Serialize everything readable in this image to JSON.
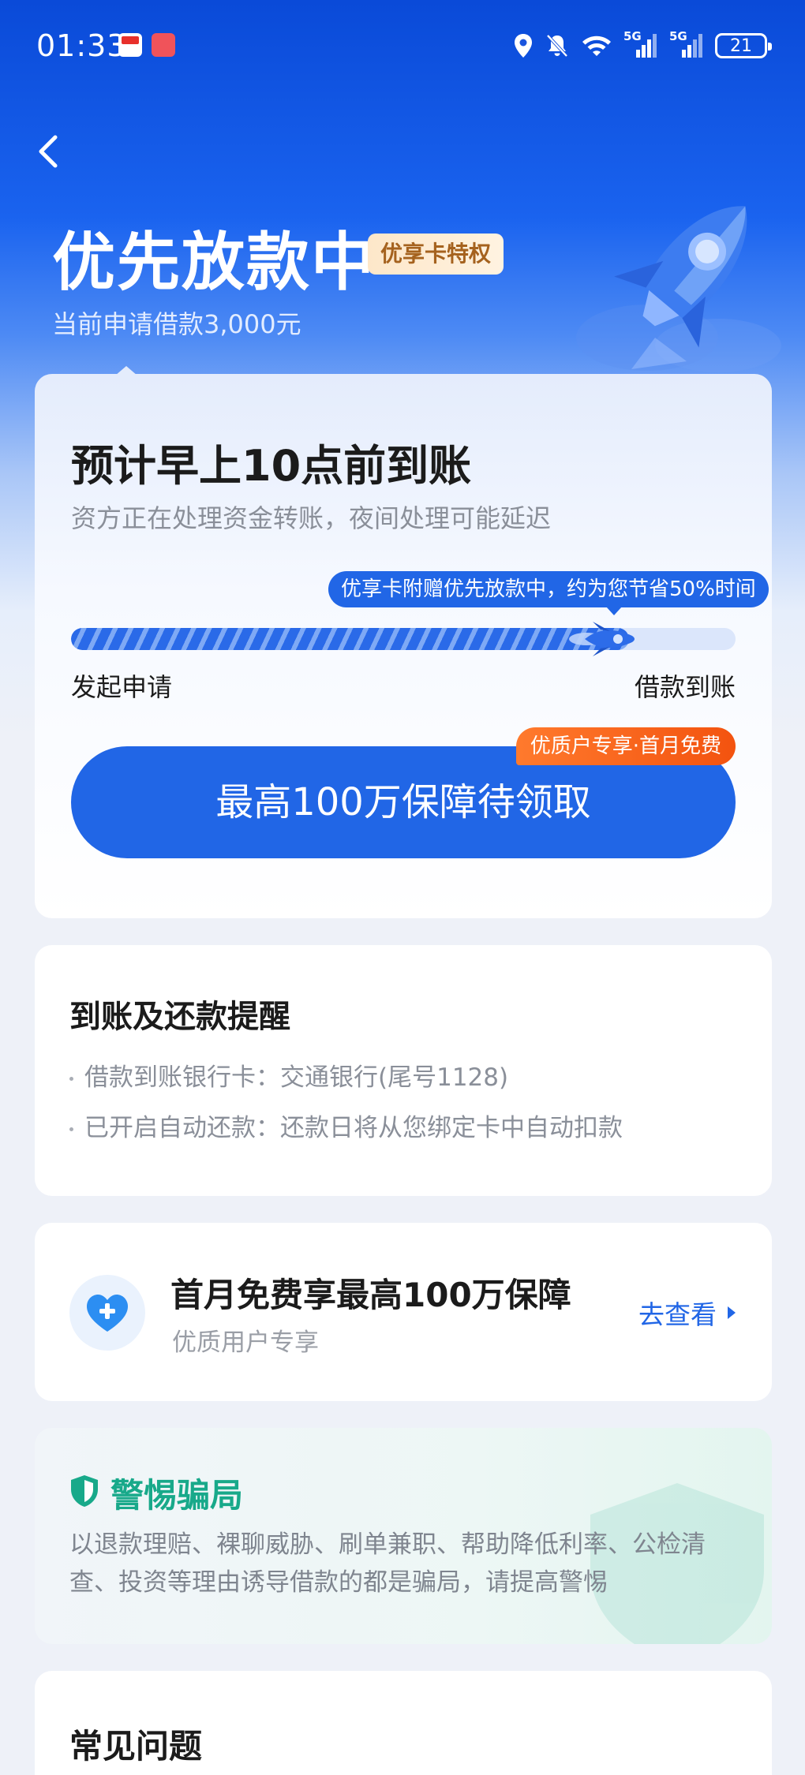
{
  "status_bar": {
    "time": "01:33",
    "battery": "21",
    "network_1": "5G",
    "network_2": "5G"
  },
  "header": {
    "title": "优先放款中",
    "badge": "优享卡特权",
    "subtitle": "当前申请借款3,000元"
  },
  "progress_card": {
    "title": "预计早上10点前到账",
    "description": "资方正在处理资金转账，夜间处理可能延迟",
    "tip": "优享卡附赠优先放款中，约为您节省50%时间",
    "progress": 0.84,
    "start_label": "发起申请",
    "end_label": "借款到账",
    "promo_tag": "优质户专享·首月免费",
    "cta_label": "最高100万保障待领取"
  },
  "reminder_card": {
    "title": "到账及还款提醒",
    "items": [
      "借款到账银行卡：交通银行(尾号1128)",
      "已开启自动还款：还款日将从您绑定卡中自动扣款"
    ]
  },
  "insurance_card": {
    "title": "首月免费享最高100万保障",
    "subtitle": "优质用户专享",
    "link": "去查看",
    "icon": "heart-plus-icon"
  },
  "fraud_card": {
    "title": "警惕骗局",
    "text": "以退款理赔、裸聊威胁、刷单兼职、帮助降低利率、公检清查、投资等理由诱导借款的都是骗局，请提高警惕",
    "icon": "shield-icon"
  },
  "faq_card": {
    "title": "常见问题"
  },
  "colors": {
    "primary": "#2166e6",
    "header_bg": "#0a4ad8",
    "promo": "#f3530f",
    "safety": "#18a98a",
    "badge_text": "#a5621e"
  }
}
